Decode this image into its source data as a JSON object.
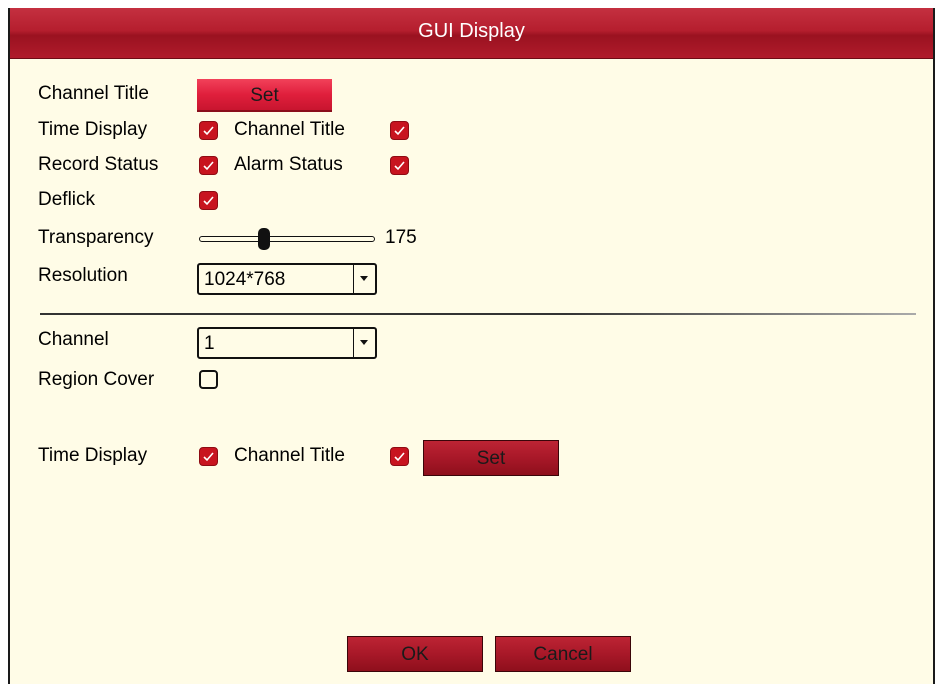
{
  "window": {
    "title": "GUI Display"
  },
  "display": {
    "channel_title_label": "Channel Title",
    "set_button": "Set",
    "time_display_label": "Time Display",
    "time_display_checked": true,
    "channel_title_check_label": "Channel Title",
    "channel_title_checked": true,
    "record_status_label": "Record Status",
    "record_status_checked": true,
    "alarm_status_label": "Alarm Status",
    "alarm_status_checked": true,
    "deflick_label": "Deflick",
    "deflick_checked": true,
    "transparency_label": "Transparency",
    "transparency_value": "175",
    "resolution_label": "Resolution",
    "resolution_value": "1024*768"
  },
  "channel_section": {
    "channel_label": "Channel",
    "channel_value": "1",
    "region_cover_label": "Region Cover",
    "region_cover_checked": false,
    "time_display_label": "Time Display",
    "time_display_checked": true,
    "channel_title_label": "Channel Title",
    "channel_title_checked": true,
    "set_button": "Set"
  },
  "footer": {
    "ok_button": "OK",
    "cancel_button": "Cancel"
  },
  "icons": {
    "check": "checkmark-icon",
    "dropdown": "chevron-down-icon"
  },
  "colors": {
    "title_bar": "#b51e2e",
    "background": "#fffce7",
    "checkbox_checked": "#c8141f",
    "button_red": "#e01f3c"
  }
}
